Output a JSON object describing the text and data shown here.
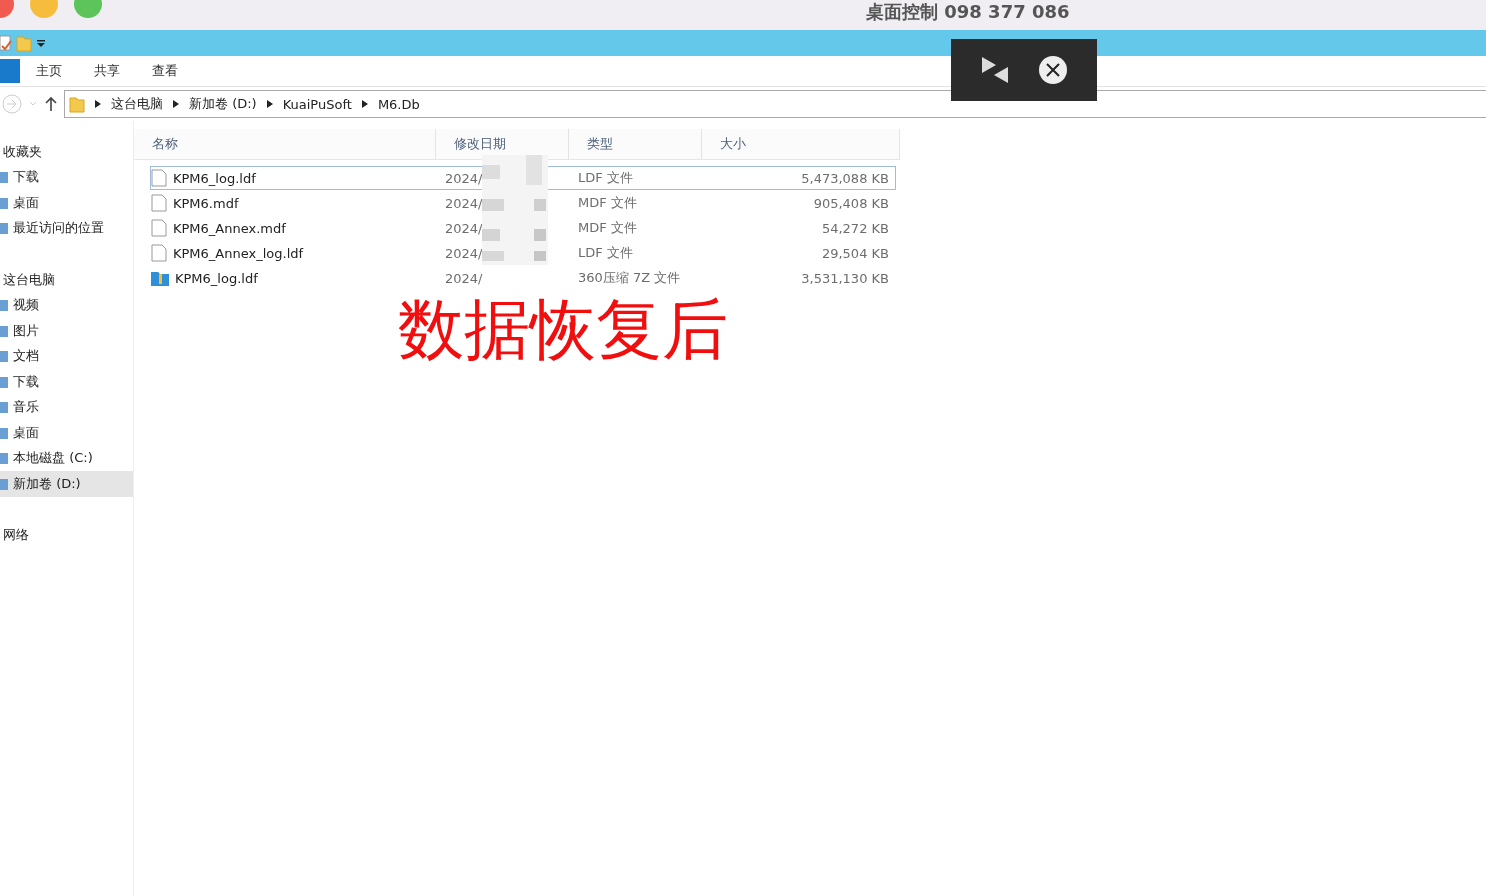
{
  "screen_title": "桌面控制 098 377 086",
  "ribbon_tabs": [
    {
      "label": "主页"
    },
    {
      "label": "共享"
    },
    {
      "label": "查看"
    }
  ],
  "breadcrumb": [
    "这台电脑",
    "新加卷 (D:)",
    "KuaiPuSoft",
    "M6.Db"
  ],
  "sidebar": [
    {
      "label": "收藏夹",
      "kind": "group",
      "selected": false
    },
    {
      "label": "下载",
      "kind": "item",
      "selected": false
    },
    {
      "label": "桌面",
      "kind": "item",
      "selected": false
    },
    {
      "label": "最近访问的位置",
      "kind": "item",
      "selected": false
    },
    {
      "label": "这台电脑",
      "kind": "group",
      "selected": false
    },
    {
      "label": "视频",
      "kind": "item",
      "selected": false
    },
    {
      "label": "图片",
      "kind": "item",
      "selected": false
    },
    {
      "label": "文档",
      "kind": "item",
      "selected": false
    },
    {
      "label": "下载",
      "kind": "item",
      "selected": false
    },
    {
      "label": "音乐",
      "kind": "item",
      "selected": false
    },
    {
      "label": "桌面",
      "kind": "item",
      "selected": false
    },
    {
      "label": "本地磁盘 (C:)",
      "kind": "item",
      "selected": false
    },
    {
      "label": "新加卷 (D:)",
      "kind": "item",
      "selected": true
    },
    {
      "label": "网络",
      "kind": "group",
      "selected": false
    }
  ],
  "table": {
    "columns": [
      "名称",
      "修改日期",
      "类型",
      "大小"
    ],
    "rows": [
      {
        "name": "KPM6_log.ldf",
        "date": "2024/",
        "type": "LDF 文件",
        "size": "5,473,088 KB",
        "kind": "file",
        "selected": true
      },
      {
        "name": "KPM6.mdf",
        "date": "2024/",
        "type": "MDF 文件",
        "size": "905,408 KB",
        "kind": "file",
        "selected": false
      },
      {
        "name": "KPM6_Annex.mdf",
        "date": "2024/",
        "type": "MDF 文件",
        "size": "54,272 KB",
        "kind": "file",
        "selected": false
      },
      {
        "name": "KPM6_Annex_log.ldf",
        "date": "2024/",
        "type": "LDF 文件",
        "size": "29,504 KB",
        "kind": "file",
        "selected": false
      },
      {
        "name": "KPM6_log.ldf",
        "date": "2024/",
        "type": "360压缩 7Z 文件",
        "size": "3,531,130 KB",
        "kind": "archive",
        "selected": false
      }
    ]
  },
  "caption": "数据恢复后"
}
